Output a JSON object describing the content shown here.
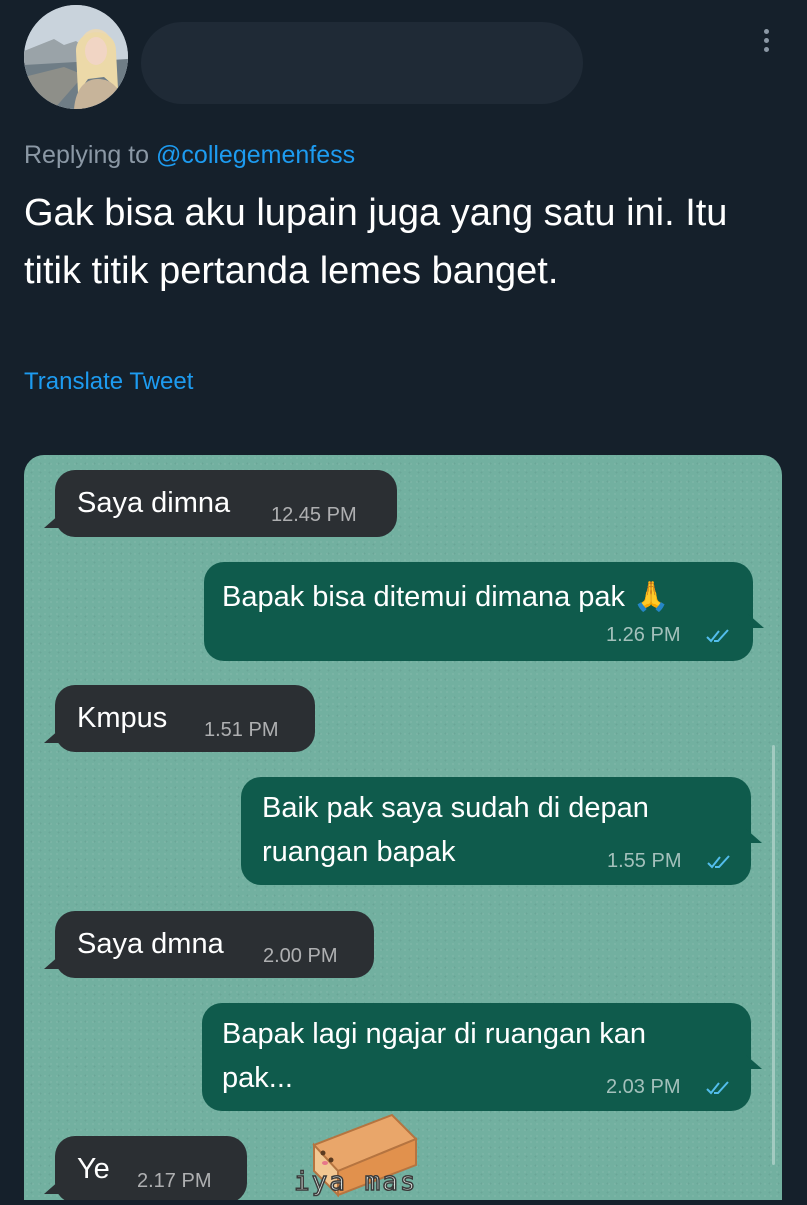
{
  "tweet": {
    "replying_prefix": "Replying to",
    "replying_handle": "@collegemenfess",
    "text": "Gak bisa aku lupain juga yang satu ini. Itu titik titik pertanda lemes banget.",
    "translate_label": "Translate Tweet"
  },
  "icons": {
    "more": "more-vertical-icon",
    "read_receipt": "double-check-icon",
    "pray_emoji": "🙏"
  },
  "colors": {
    "background": "#15202b",
    "link": "#1d9bf0",
    "incoming_bubble": "#2b2f33",
    "outgoing_bubble": "#0f5b4c",
    "chat_wallpaper": "#72b0a0",
    "read_tick": "#53bdeb"
  },
  "chat": {
    "messages": [
      {
        "direction": "in",
        "text": "Saya dimna",
        "time": "12.45 PM"
      },
      {
        "direction": "out",
        "text": "Bapak bisa ditemui dimana pak",
        "emoji": "🙏",
        "time": "1.26 PM"
      },
      {
        "direction": "in",
        "text": "Kmpus",
        "time": "1.51 PM"
      },
      {
        "direction": "out",
        "text_line1": "Baik pak saya sudah di depan",
        "text_line2": "ruangan bapak",
        "time": "1.55 PM"
      },
      {
        "direction": "in",
        "text": "Saya dmna",
        "time": "2.00 PM"
      },
      {
        "direction": "out",
        "text_line1": "Bapak lagi ngajar di ruangan kan",
        "text_line2": "pak...",
        "time": "2.03 PM"
      },
      {
        "direction": "in",
        "text": "Ye",
        "time": "2.17 PM"
      }
    ],
    "sticker_caption": "iya mas"
  }
}
